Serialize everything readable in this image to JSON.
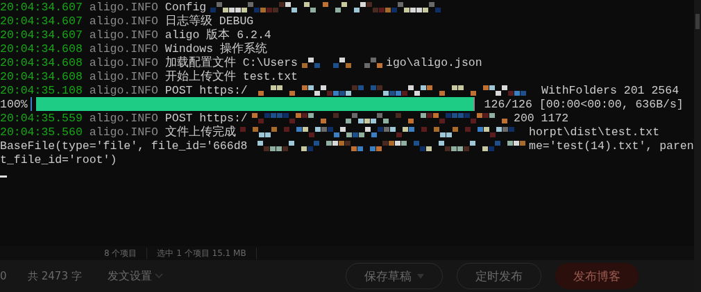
{
  "terminal": {
    "lines": [
      {
        "kind": "log",
        "time": "20:04:34.607",
        "logger": "aligo.INFO",
        "segments": [
          {
            "kind": "text",
            "text": "Config"
          },
          {
            "kind": "redacted"
          }
        ]
      },
      {
        "kind": "log",
        "time": "20:04:34.607",
        "logger": "aligo.INFO",
        "segments": [
          {
            "kind": "text",
            "text": "日志等级 DEBUG"
          }
        ]
      },
      {
        "kind": "log",
        "time": "20:04:34.607",
        "logger": "aligo.INFO",
        "segments": [
          {
            "kind": "text",
            "text": "aligo 版本 6.2.4"
          }
        ]
      },
      {
        "kind": "log",
        "time": "20:04:34.608",
        "logger": "aligo.INFO",
        "segments": [
          {
            "kind": "text",
            "text": "Windows 操作系统"
          }
        ]
      },
      {
        "kind": "log",
        "time": "20:04:34.608",
        "logger": "aligo.INFO",
        "segments": [
          {
            "kind": "text",
            "text": "加载配置文件 C:\\Users"
          },
          {
            "kind": "redacted"
          },
          {
            "kind": "text",
            "text": "igo\\aligo.json"
          }
        ]
      },
      {
        "kind": "log",
        "time": "20:04:34.608",
        "logger": "aligo.INFO",
        "segments": [
          {
            "kind": "text",
            "text": "开始上传文件 test.txt"
          }
        ]
      },
      {
        "kind": "log",
        "time": "20:04:35.108",
        "logger": "aligo.INFO",
        "segments": [
          {
            "kind": "text",
            "text": "POST https:/"
          },
          {
            "kind": "redacted"
          },
          {
            "kind": "text",
            "text": "WithFolders 201 2564"
          }
        ]
      },
      {
        "kind": "progress",
        "percent": "100%",
        "level": 1,
        "stats": "126/126 [00:00<00:00, 636B/s]"
      },
      {
        "kind": "log",
        "time": "20:04:35.559",
        "logger": "aligo.INFO",
        "segments": [
          {
            "kind": "text",
            "text": "POST https:/"
          },
          {
            "kind": "redacted"
          },
          {
            "kind": "text",
            "text": "200 1172"
          }
        ]
      },
      {
        "kind": "log",
        "time": "20:04:35.560",
        "logger": "aligo.INFO",
        "segments": [
          {
            "kind": "text",
            "text": "文件上传完成"
          },
          {
            "kind": "redacted"
          },
          {
            "kind": "text",
            "text": "horpt\\dist\\test.txt"
          }
        ]
      },
      {
        "kind": "plain",
        "segments": [
          {
            "kind": "text",
            "text": "BaseFile(type='file', file_id='666d8"
          },
          {
            "kind": "redacted"
          },
          {
            "kind": "text",
            "text": "me='test(14).txt', paren"
          }
        ]
      },
      {
        "kind": "plain",
        "segments": [
          {
            "kind": "text",
            "text": "t_file_id='root')"
          }
        ]
      }
    ]
  },
  "explorer_status": {
    "items": [
      "8 个项目",
      "选中 1 个项目  15.1 MB"
    ]
  },
  "editor_bar": {
    "fragment": "0",
    "word_count": "共 2473 字",
    "settings": "发文设置",
    "buttons": [
      {
        "label": "保存草稿",
        "kind": "dropdown"
      },
      {
        "label": "定时发布",
        "kind": "outline"
      },
      {
        "label": "发布博客",
        "kind": "primary"
      }
    ]
  }
}
